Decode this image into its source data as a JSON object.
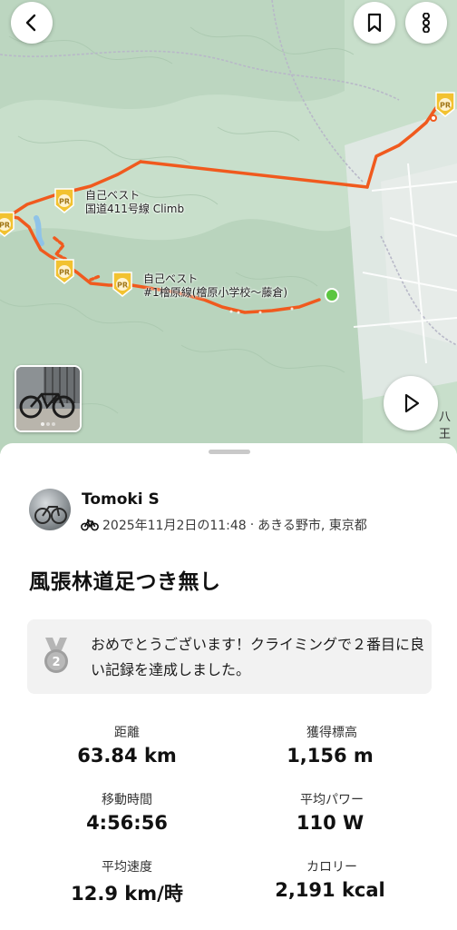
{
  "map": {
    "segments": [
      {
        "line1": "自己ベスト",
        "line2": "国道411号線 Climb"
      },
      {
        "line1": "自己ベスト",
        "line2": "#1檜原線(檜原小学校〜藤倉)"
      }
    ],
    "pr_badge_text": "PR",
    "edge_label": "八王"
  },
  "header": {
    "back_icon": "back-arrow-icon",
    "bookmark_icon": "bookmark-icon",
    "more_icon": "more-vertical-icon"
  },
  "athlete": {
    "name": "Tomoki S",
    "sport_icon": "bike-icon",
    "date_time": "2025年11月2日の11:48",
    "separator": "·",
    "location": "あきる野市, 東京都"
  },
  "activity": {
    "title": "風張林道足つき無し"
  },
  "achievement": {
    "medal_number": "2",
    "text": "おめでとうございます！クライミングで２番目に良い記録を達成しました。"
  },
  "stats": [
    {
      "label": "距離",
      "value": "63.84 km"
    },
    {
      "label": "獲得標高",
      "value": "1,156 m"
    },
    {
      "label": "移動時間",
      "value": "4:56:56"
    },
    {
      "label": "平均パワー",
      "value": "110 W"
    },
    {
      "label": "平均速度",
      "value": "12.9 km/時"
    },
    {
      "label": "カロリー",
      "value": "2,191 kcal"
    }
  ],
  "colors": {
    "route": "#f05a1e",
    "pr_badge": "#f2c230",
    "end_marker": "#5cc640"
  }
}
